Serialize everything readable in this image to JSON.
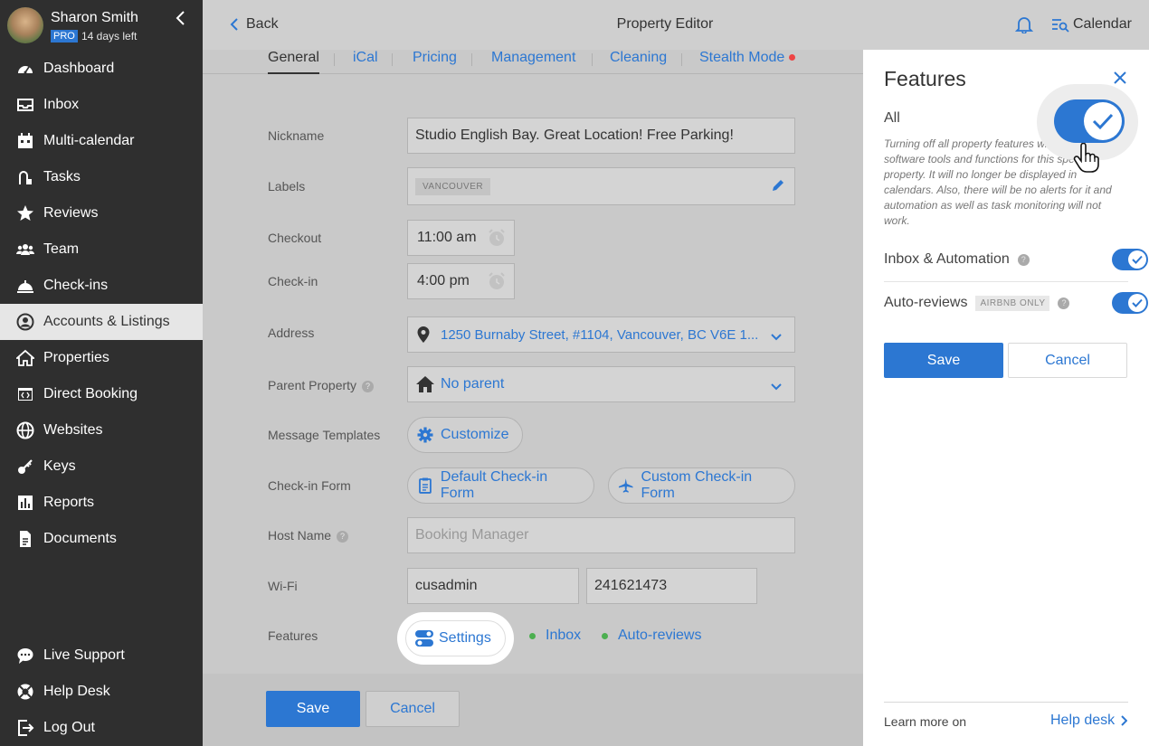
{
  "user": {
    "name": "Sharon Smith",
    "plan": "PRO",
    "trial": "14 days left"
  },
  "nav": {
    "items": [
      {
        "label": "Dashboard",
        "icon": "dashboard-icon"
      },
      {
        "label": "Inbox",
        "icon": "inbox-icon"
      },
      {
        "label": "Multi-calendar",
        "icon": "calendar-icon"
      },
      {
        "label": "Tasks",
        "icon": "tasks-icon"
      },
      {
        "label": "Reviews",
        "icon": "star-icon"
      },
      {
        "label": "Team",
        "icon": "team-icon"
      },
      {
        "label": "Check-ins",
        "icon": "bell-desk-icon"
      },
      {
        "label": "Accounts & Listings",
        "icon": "user-icon"
      },
      {
        "label": "Properties",
        "icon": "home-icon"
      },
      {
        "label": "Direct Booking",
        "icon": "code-window-icon"
      },
      {
        "label": "Websites",
        "icon": "globe-icon"
      },
      {
        "label": "Keys",
        "icon": "key-icon"
      },
      {
        "label": "Reports",
        "icon": "reports-icon"
      },
      {
        "label": "Documents",
        "icon": "document-icon"
      }
    ],
    "bottom": [
      {
        "label": "Live Support",
        "icon": "chat-icon"
      },
      {
        "label": "Help Desk",
        "icon": "lifebuoy-icon"
      },
      {
        "label": "Log Out",
        "icon": "logout-icon"
      }
    ],
    "active_index": 7
  },
  "header": {
    "back": "Back",
    "title": "Property Editor",
    "calendar": "Calendar"
  },
  "tabs": [
    "General",
    "iCal",
    "Pricing",
    "Management",
    "Cleaning",
    "Stealth Mode"
  ],
  "form": {
    "nickname_label": "Nickname",
    "nickname_value": "Studio English Bay. Great Location! Free Parking!",
    "labels_label": "Labels",
    "labels_chip": "VANCOUVER",
    "checkout_label": "Checkout",
    "checkout_value": "11:00 am",
    "checkin_label": "Check-in",
    "checkin_value": "4:00 pm",
    "address_label": "Address",
    "address_value": "1250 Burnaby Street, #1104, Vancouver, BC V6E 1...",
    "parent_label": "Parent Property",
    "parent_value": "No parent",
    "templates_label": "Message Templates",
    "templates_button": "Customize",
    "checkin_form_label": "Check-in Form",
    "default_form": "Default Check-in Form",
    "custom_form": "Custom Check-in Form",
    "host_label": "Host Name",
    "host_placeholder": "Booking Manager",
    "wifi_label": "Wi-Fi",
    "wifi_name": "cusadmin",
    "wifi_password": "241621473",
    "features_label": "Features",
    "settings_button": "Settings",
    "feature_inbox": "Inbox",
    "feature_reviews": "Auto-reviews",
    "help_mark": "?"
  },
  "footer": {
    "save": "Save",
    "cancel": "Cancel"
  },
  "panel": {
    "title": "Features",
    "all_label": "All",
    "description": "Turning off all property features will disable software tools and functions for this specific property. It will no longer be displayed in calendars. Also, there will be no alerts for it and automation as well as task monitoring will not work.",
    "inbox_automation": "Inbox & Automation",
    "auto_reviews": "Auto-reviews",
    "airbnb_only": "AIRBNB ONLY",
    "help_mark": "?",
    "save": "Save",
    "cancel": "Cancel",
    "learn_more": "Learn more on",
    "help_desk": "Help desk"
  },
  "colors": {
    "accent": "#2c77d2",
    "sidebar": "#2f2f2f",
    "active_dot": "#4caf50",
    "stealth_dot": "#e44444"
  }
}
